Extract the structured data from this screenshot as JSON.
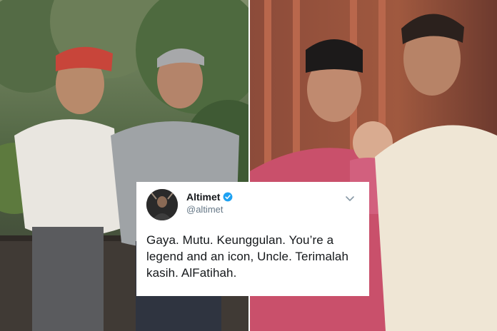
{
  "tweet": {
    "display_name": "Altimet",
    "handle": "@altimet",
    "text": "Gaya. Mutu. Keunggulan. You’re a legend and an icon, Uncle. Terimalah kasih. AlFatihah.",
    "verified": true,
    "icons": {
      "verified": "verified-badge-icon",
      "menu": "chevron-down-icon"
    }
  },
  "colors": {
    "verified_blue": "#1da1f2",
    "text_primary": "#14171a",
    "text_secondary": "#657786"
  }
}
